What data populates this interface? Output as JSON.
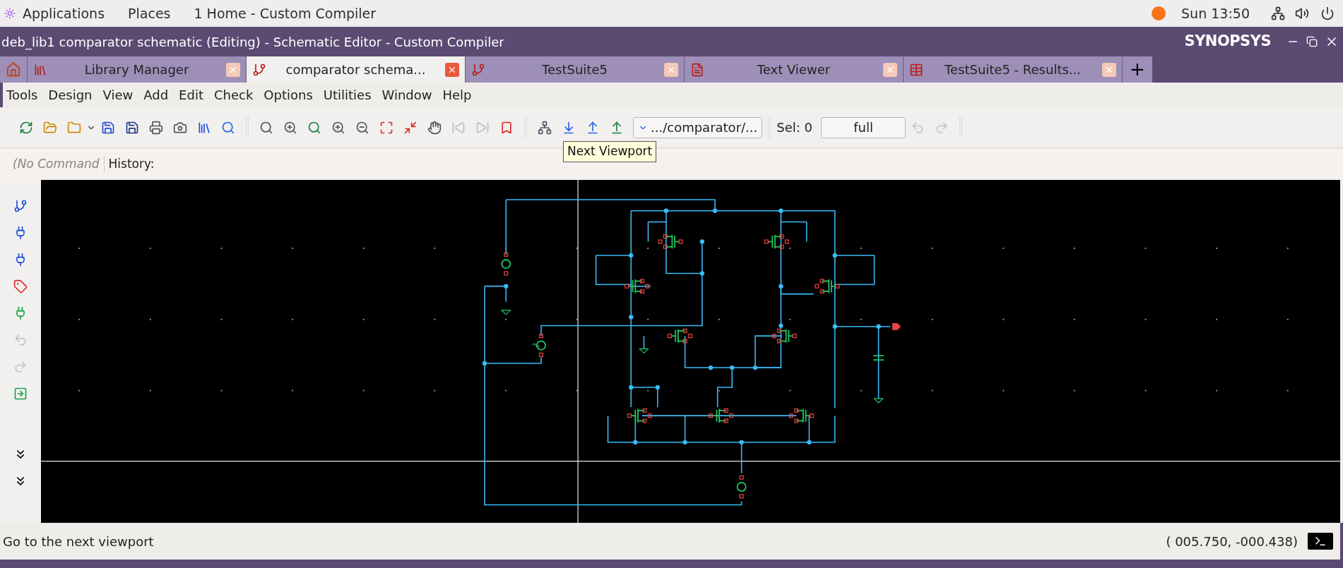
{
  "top_bar": {
    "menus": [
      "Applications",
      "Places",
      "1 Home - Custom Compiler"
    ],
    "clock": "Sun 13:50"
  },
  "window": {
    "title": "deb_lib1 comparator schematic (Editing) - Schematic Editor - Custom Compiler",
    "brand": "SYNOPSYS"
  },
  "tabs": [
    {
      "label": "Library Manager",
      "selected": false
    },
    {
      "label": "comparator schema...",
      "selected": true
    },
    {
      "label": "TestSuite5",
      "selected": false
    },
    {
      "label": "Text Viewer",
      "selected": false
    },
    {
      "label": "TestSuite5 - Results...",
      "selected": false
    }
  ],
  "new_tab": "+",
  "menu": [
    "Tools",
    "Design",
    "View",
    "Add",
    "Edit",
    "Check",
    "Options",
    "Utilities",
    "Window",
    "Help"
  ],
  "toolbar": {
    "hierarchy_path": ".../comparator/...",
    "selection": "Sel: 0",
    "view_mode": "full"
  },
  "tooltip": "Next Viewport",
  "command_line": {
    "placeholder": "(No Command",
    "history_label": "History:"
  },
  "status_bar": {
    "message": "Go to the next viewport",
    "coordinates": "( 005.750, -000.438)"
  }
}
